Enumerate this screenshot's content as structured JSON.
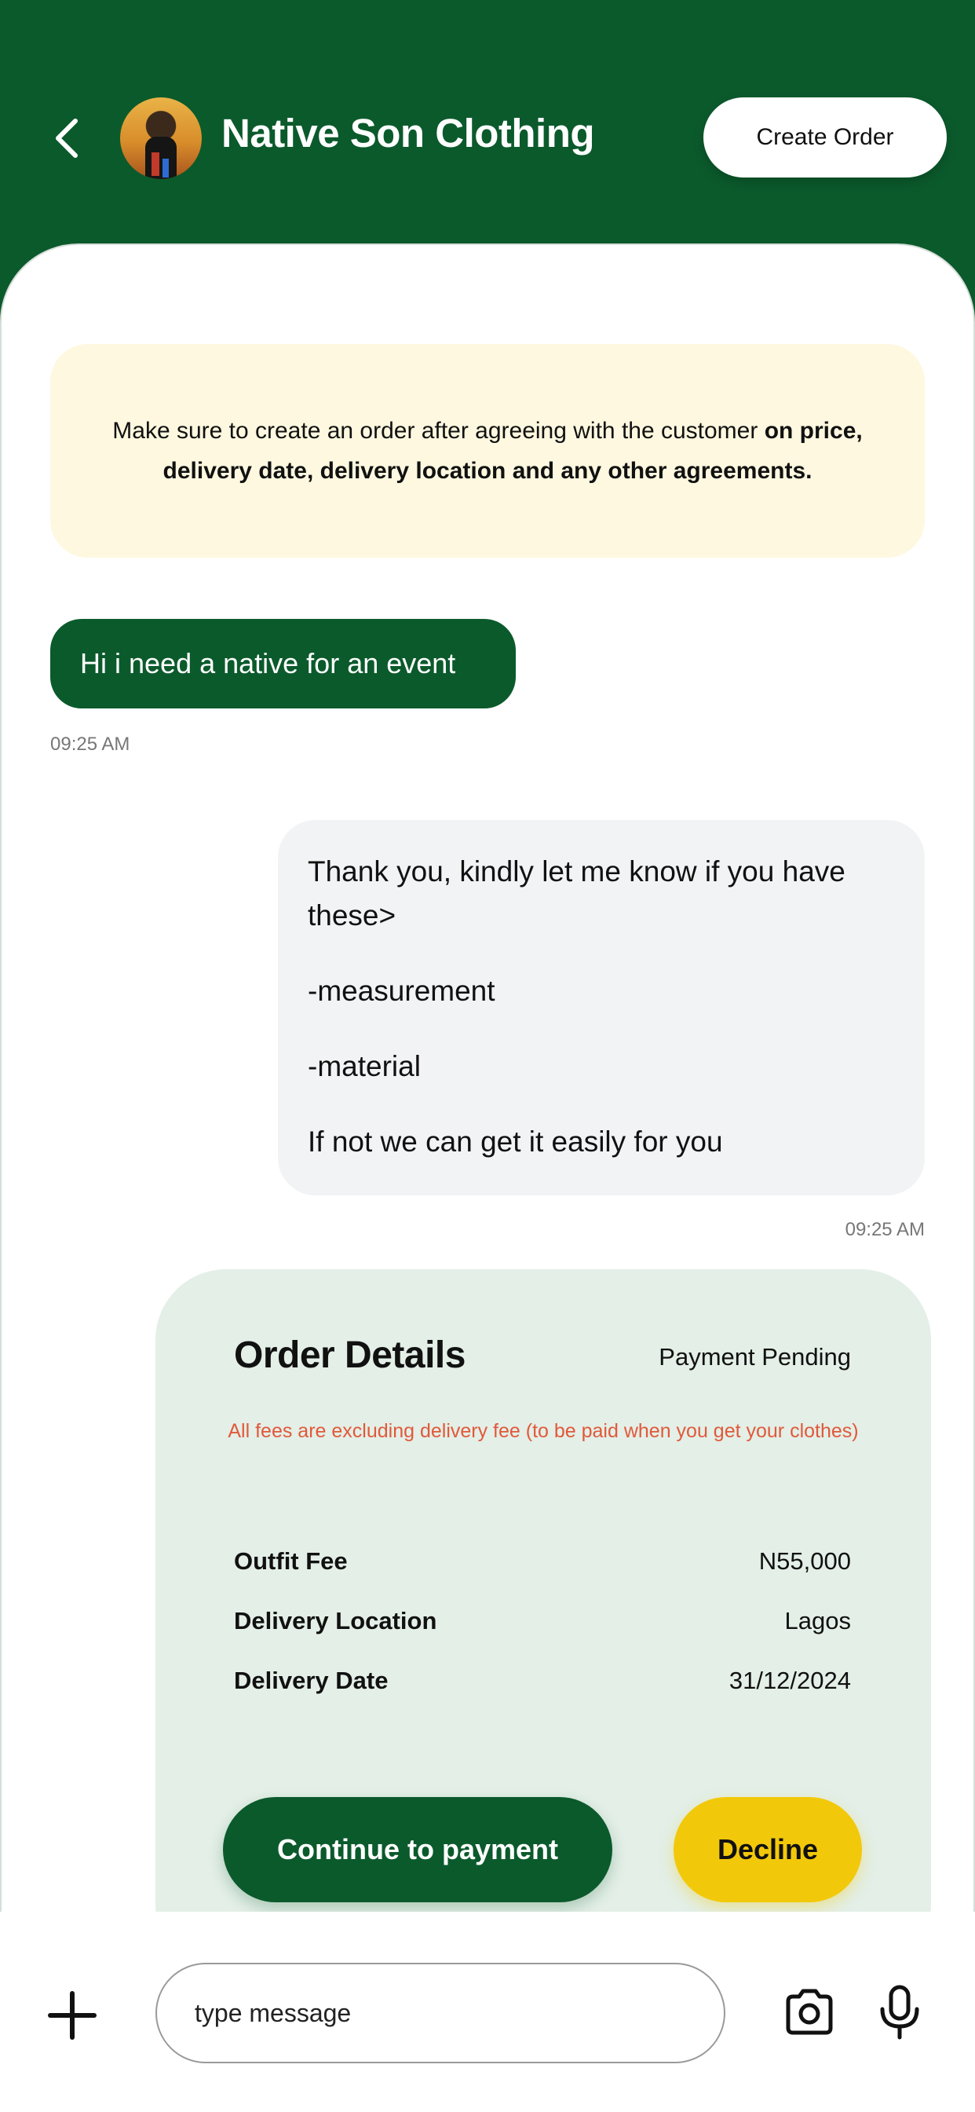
{
  "header": {
    "shop_name": "Native Son Clothing",
    "create_order_label": "Create Order",
    "back_icon": "chevron-left-icon",
    "brand_color": "#0b5a2c"
  },
  "notice": {
    "text_plain": "Make sure to create an order after agreeing with the customer ",
    "text_bold": "on price, delivery date, delivery location and any other agreements."
  },
  "messages": [
    {
      "direction": "incoming",
      "text": "Hi i need a native for an event",
      "time": "09:25 AM"
    },
    {
      "direction": "outgoing",
      "lines": [
        "Thank you, kindly let me know if you have these>",
        "-measurement",
        "-material",
        "If not we can get it easily for you"
      ],
      "time": "09:25 AM"
    }
  ],
  "order": {
    "title": "Order Details",
    "status": "Payment Pending",
    "note": "All fees are excluding delivery fee (to be paid when you get your clothes)",
    "rows": [
      {
        "label": "Outfit Fee",
        "value": "N55,000"
      },
      {
        "label": "Delivery Location",
        "value": "Lagos"
      },
      {
        "label": "Delivery Date",
        "value": "31/12/2024"
      }
    ],
    "pay_label": "Continue to payment",
    "decline_label": "Decline",
    "accent_yellow": "#f2c80a",
    "note_color": "#e1593a"
  },
  "composer": {
    "placeholder": "type message",
    "icons": [
      "plus-icon",
      "camera-icon",
      "microphone-icon"
    ]
  }
}
